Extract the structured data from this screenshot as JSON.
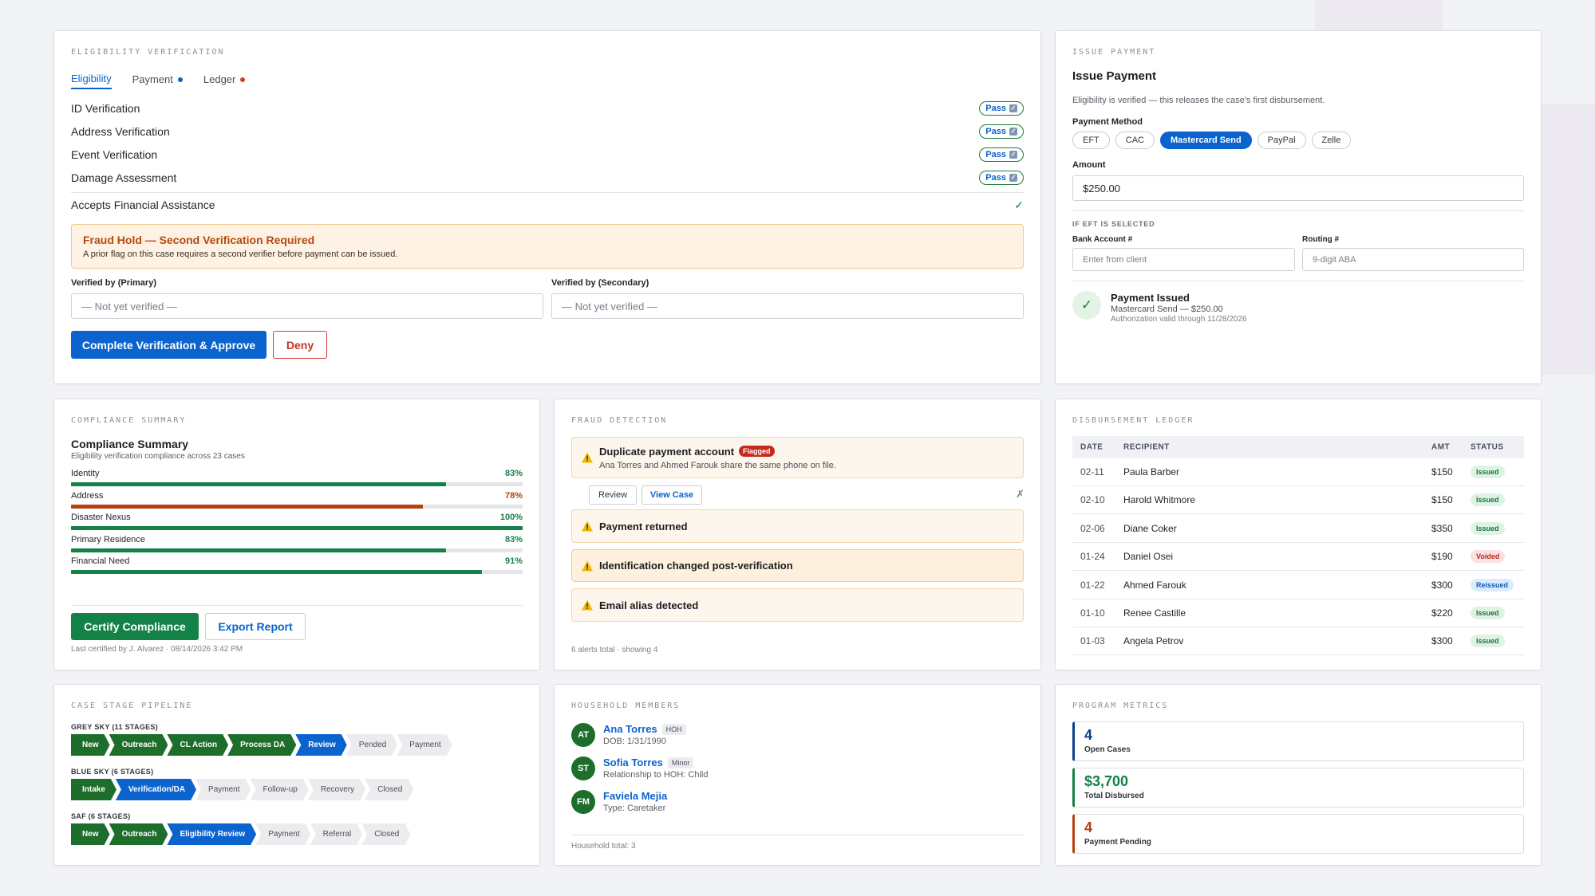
{
  "eligibility": {
    "section_title": "ELIGIBILITY VERIFICATION",
    "tabs": [
      {
        "label": "Eligibility",
        "dot": ""
      },
      {
        "label": "Payment",
        "dot": "#0b63ce"
      },
      {
        "label": "Ledger",
        "dot": "#d33b2f"
      }
    ],
    "checks": [
      {
        "label": "ID Verification",
        "status": "Pass"
      },
      {
        "label": "Address Verification",
        "status": "Pass"
      },
      {
        "label": "Event Verification",
        "status": "Pass"
      },
      {
        "label": "Damage Assessment",
        "status": "Pass"
      }
    ],
    "financial_label": "Accepts Financial Assistance",
    "financial_check": "✓",
    "fraud_title": "Fraud Hold — Second Verification Required",
    "fraud_text": "A prior flag on this case requires a second verifier before payment can be issued.",
    "primary_label": "Verified by (Primary)",
    "primary_placeholder": "— Not yet verified —",
    "secondary_label": "Verified by (Secondary)",
    "secondary_placeholder": "— Not yet verified —",
    "approve_label": "Complete Verification & Approve",
    "deny_label": "Deny"
  },
  "payment": {
    "section_title": "ISSUE PAYMENT",
    "title": "Issue Payment",
    "subtitle": "Eligibility is verified — this releases the case's first disbursement.",
    "method_label": "Payment Method",
    "methods": [
      "EFT",
      "CAC",
      "Mastercard Send",
      "PayPal",
      "Zelle"
    ],
    "selected_method": "Mastercard Send",
    "amount_label": "Amount",
    "amount_value": "$250.00",
    "eft_heading": "IF EFT IS SELECTED",
    "bank_label": "Bank Account #",
    "bank_placeholder": "Enter from client",
    "routing_label": "Routing #",
    "routing_placeholder": "9-digit ABA",
    "issued_title": "Payment Issued",
    "issued_detail": "Mastercard Send — $250.00",
    "issued_valid": "Authorization valid through 11/28/2026"
  },
  "compliance": {
    "section_title": "COMPLIANCE SUMMARY",
    "title": "Compliance Summary",
    "subtitle": "Eligibility verification compliance across 23 cases",
    "rows": [
      {
        "label": "Identity",
        "pct": "83%",
        "value": 83,
        "color": "#148147"
      },
      {
        "label": "Address",
        "pct": "78%",
        "value": 78,
        "color": "#b5400f"
      },
      {
        "label": "Disaster Nexus",
        "pct": "100%",
        "value": 100,
        "color": "#148147"
      },
      {
        "label": "Primary Residence",
        "pct": "83%",
        "value": 83,
        "color": "#148147"
      },
      {
        "label": "Financial Need",
        "pct": "91%",
        "value": 91,
        "color": "#148147"
      }
    ],
    "certify_label": "Certify Compliance",
    "export_label": "Export Report",
    "footer": "Last certified by J. Alvarez · 08/14/2026 3:42 PM"
  },
  "fraud": {
    "section_title": "FRAUD DETECTION",
    "alert1_title": "Duplicate payment account",
    "alert1_flag": "Flagged",
    "alert1_text": "Ana Torres and Ahmed Farouk share the same phone on file.",
    "review_label": "Review",
    "viewcase_label": "View Case",
    "dismiss": "✗",
    "alert2_title": "Payment returned",
    "alert3_title": "Identification changed post-verification",
    "alert4_title": "Email alias detected",
    "footer": "6 alerts total · showing 4"
  },
  "ledger": {
    "section_title": "DISBURSEMENT LEDGER",
    "headers": {
      "date": "DATE",
      "recipient": "RECIPIENT",
      "amt": "AMT",
      "status": "STATUS"
    },
    "rows": [
      {
        "date": "02-11",
        "recipient": "Paula Barber",
        "amt": "$150",
        "status": "Issued",
        "kind": "issued"
      },
      {
        "date": "02-10",
        "recipient": "Harold Whitmore",
        "amt": "$150",
        "status": "Issued",
        "kind": "issued"
      },
      {
        "date": "02-06",
        "recipient": "Diane Coker",
        "amt": "$350",
        "status": "Issued",
        "kind": "issued"
      },
      {
        "date": "01-24",
        "recipient": "Daniel Osei",
        "amt": "$190",
        "status": "Voided",
        "kind": "voided"
      },
      {
        "date": "01-22",
        "recipient": "Ahmed Farouk",
        "amt": "$300",
        "status": "Reissued",
        "kind": "reissued"
      },
      {
        "date": "01-10",
        "recipient": "Renee Castille",
        "amt": "$220",
        "status": "Issued",
        "kind": "issued"
      },
      {
        "date": "01-03",
        "recipient": "Angela Petrov",
        "amt": "$300",
        "status": "Issued",
        "kind": "issued"
      }
    ]
  },
  "pipeline": {
    "section_title": "CASE STAGE PIPELINE",
    "groups": [
      {
        "label": "GREY SKY (11 STAGES)",
        "stages": [
          {
            "name": "New",
            "state": "g"
          },
          {
            "name": "Outreach",
            "state": "g"
          },
          {
            "name": "CL Action",
            "state": "g"
          },
          {
            "name": "Process DA",
            "state": "g"
          },
          {
            "name": "Review",
            "state": "b"
          },
          {
            "name": "Pended",
            "state": "x"
          },
          {
            "name": "Payment",
            "state": "x"
          }
        ]
      },
      {
        "label": "BLUE SKY (6 STAGES)",
        "stages": [
          {
            "name": "Intake",
            "state": "g"
          },
          {
            "name": "Verification/DA",
            "state": "b"
          },
          {
            "name": "Payment",
            "state": "x"
          },
          {
            "name": "Follow-up",
            "state": "x"
          },
          {
            "name": "Recovery",
            "state": "x"
          },
          {
            "name": "Closed",
            "state": "x"
          }
        ]
      },
      {
        "label": "SAF (6 STAGES)",
        "stages": [
          {
            "name": "New",
            "state": "g"
          },
          {
            "name": "Outreach",
            "state": "g"
          },
          {
            "name": "Eligibility Review",
            "state": "b"
          },
          {
            "name": "Payment",
            "state": "x"
          },
          {
            "name": "Referral",
            "state": "x"
          },
          {
            "name": "Closed",
            "state": "x"
          }
        ]
      }
    ]
  },
  "household": {
    "section_title": "HOUSEHOLD MEMBERS",
    "members": [
      {
        "initials": "AT",
        "name": "Ana Torres",
        "tag": "HOH",
        "sub": "DOB: 1/31/1990"
      },
      {
        "initials": "ST",
        "name": "Sofia Torres",
        "tag": "Minor",
        "sub": "Relationship to HOH: Child"
      },
      {
        "initials": "FM",
        "name": "Faviela Mejia",
        "tag": "",
        "sub": "Type: Caretaker"
      }
    ],
    "footer": "Household total: 3"
  },
  "metrics": {
    "section_title": "PROGRAM METRICS",
    "items": [
      {
        "value": "4",
        "label": "Open Cases",
        "color": "#0b3f8c"
      },
      {
        "value": "$3,700",
        "label": "Total Disbursed",
        "color": "#148147"
      },
      {
        "value": "4",
        "label": "Payment Pending",
        "color": "#b5400f"
      }
    ]
  }
}
